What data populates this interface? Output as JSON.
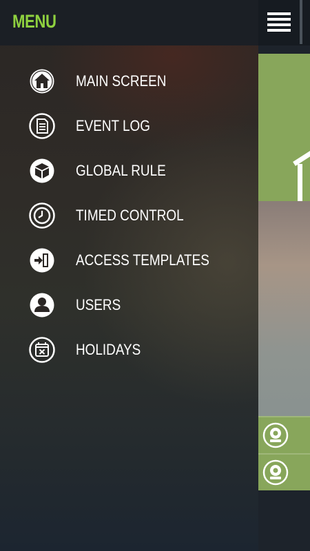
{
  "drawer": {
    "title": "MENU",
    "title_color": "#8fd13f",
    "items": [
      {
        "label": "MAIN SCREEN",
        "icon": "home-icon"
      },
      {
        "label": "EVENT LOG",
        "icon": "document-icon"
      },
      {
        "label": "GLOBAL RULE",
        "icon": "cube-icon"
      },
      {
        "label": "TIMED CONTROL",
        "icon": "clock-icon"
      },
      {
        "label": "ACCESS TEMPLATES",
        "icon": "door-enter-icon"
      },
      {
        "label": "USERS",
        "icon": "user-icon"
      },
      {
        "label": "HOLIDAYS",
        "icon": "calendar-x-icon"
      }
    ]
  },
  "background": {
    "tile_color": "#88a65b",
    "camera_rows": [
      "camera-icon",
      "camera-icon"
    ]
  }
}
